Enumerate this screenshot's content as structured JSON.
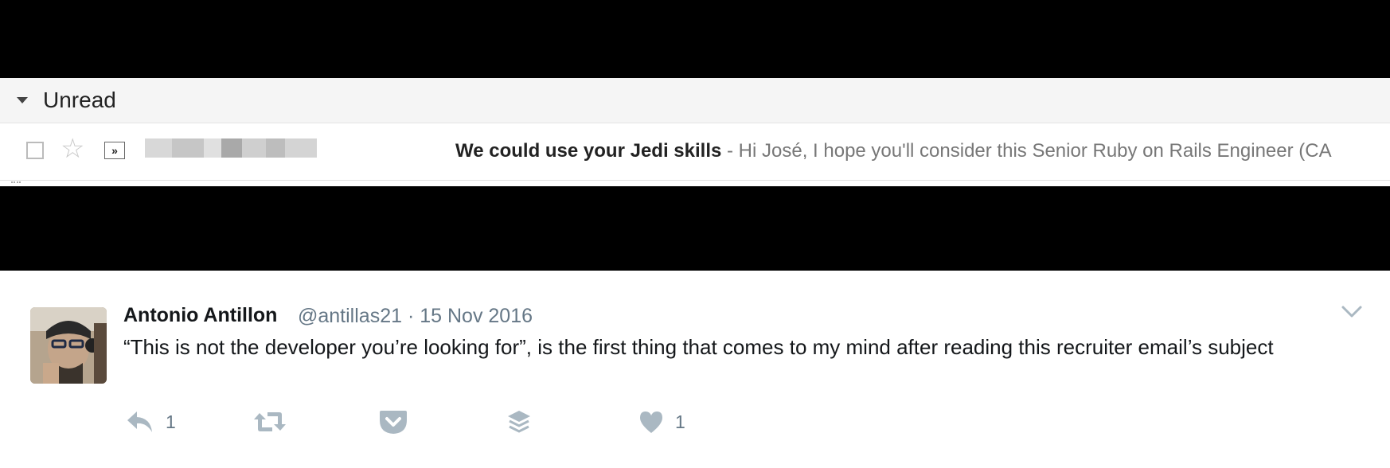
{
  "gmail": {
    "section_title": "Unread",
    "email": {
      "subject": "We could use your Jedi skills",
      "separator": " - ",
      "snippet": "Hi José, I hope you'll consider this Senior Ruby on Rails Engineer (CA"
    }
  },
  "tweet": {
    "author_name": "Antonio Antillon",
    "handle": "@antillas21",
    "dot": " · ",
    "date": "15 Nov 2016",
    "text": "“This is not the developer you’re looking for”, is the first thing that comes to my mind after reading this recruiter email’s subject",
    "reply_count": "1",
    "like_count": "1"
  },
  "icons": {
    "caret": "caret-down-icon",
    "checkbox": "checkbox-icon",
    "star": "star-icon",
    "importance": "importance-marker-icon",
    "reply": "reply-icon",
    "retweet": "retweet-icon",
    "pocket": "pocket-icon",
    "buffer": "buffer-icon",
    "like": "heart-icon",
    "more": "chevron-down-icon"
  },
  "colors": {
    "icon_gray": "#aab8c2",
    "meta_gray": "#657786",
    "text": "#14171a"
  }
}
